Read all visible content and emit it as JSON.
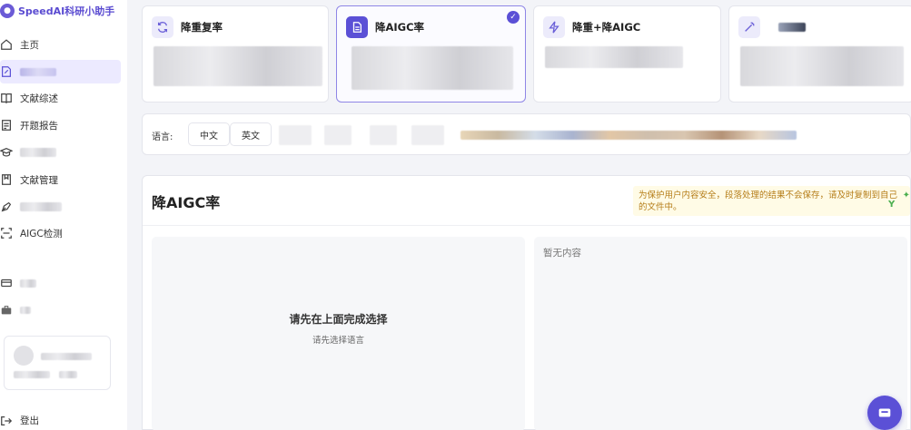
{
  "brand": {
    "title": "SpeedAI科研小助手"
  },
  "sidebar": {
    "items": [
      {
        "label": "主页",
        "icon": "home-icon"
      },
      {
        "label": "",
        "icon": "edit-doc-icon",
        "active": true
      },
      {
        "label": "文献综述",
        "icon": "book-icon"
      },
      {
        "label": "开题报告",
        "icon": "report-icon"
      },
      {
        "label": "",
        "icon": "graduation-icon"
      },
      {
        "label": "文献管理",
        "icon": "bookmark-icon"
      },
      {
        "label": "",
        "icon": "pen-icon"
      },
      {
        "label": "AIGC检测",
        "icon": "scan-icon"
      },
      {
        "label": "",
        "icon": "card-icon"
      },
      {
        "label": "",
        "icon": "briefcase-icon"
      }
    ],
    "logout_label": "登出"
  },
  "cards": [
    {
      "title": "降重复率",
      "icon": "refresh-icon",
      "selected": false
    },
    {
      "title": "降AIGC率",
      "icon": "document-icon",
      "selected": true
    },
    {
      "title": "降重+降AIGC",
      "icon": "lightning-icon",
      "selected": false
    },
    {
      "title": "",
      "icon": "magic-wand-icon",
      "selected": false
    }
  ],
  "language": {
    "label": "语言:",
    "options": [
      "中文",
      "英文"
    ]
  },
  "panel": {
    "title": "降AIGC率",
    "notice": "为保护用户内容安全，段落处理的结果不会保存，请及时复制到自己的文件中。",
    "left_empty_title": "请先在上面完成选择",
    "left_empty_sub": "请先选择语言",
    "right_empty": "暂无内容"
  },
  "colors": {
    "accent": "#5b50d6",
    "notice_bg": "#fffbe6",
    "notice_text": "#b57d18"
  }
}
